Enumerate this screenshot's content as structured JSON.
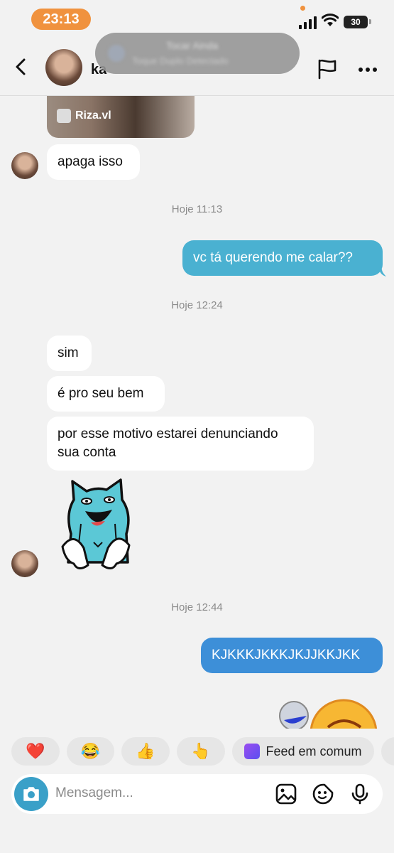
{
  "status": {
    "time": "23:13",
    "battery": "30"
  },
  "header": {
    "name": "ka"
  },
  "banner": {
    "line1": "Tocar Ainda",
    "line2": "Toque Duplo Detectado"
  },
  "media": {
    "username": "Riza.vl"
  },
  "messages": {
    "m1": "apaga isso",
    "ts1": "Hoje 11:13",
    "m2": "vc tá querendo me calar??",
    "ts2": "Hoje 12:24",
    "m3": "sim",
    "m4": "é pro seu bem",
    "m5_line1": "por esse motivo estarei denunciando",
    "m5_line2": "sua conta",
    "ts3": "Hoje 12:44",
    "m6": "KJKKKJKKKJKJJKKJKK"
  },
  "reactions": [
    "❤️",
    "😂",
    "👍",
    "👆"
  ],
  "feed_label": "Feed em comum",
  "composer": {
    "placeholder": "Mensagem..."
  }
}
